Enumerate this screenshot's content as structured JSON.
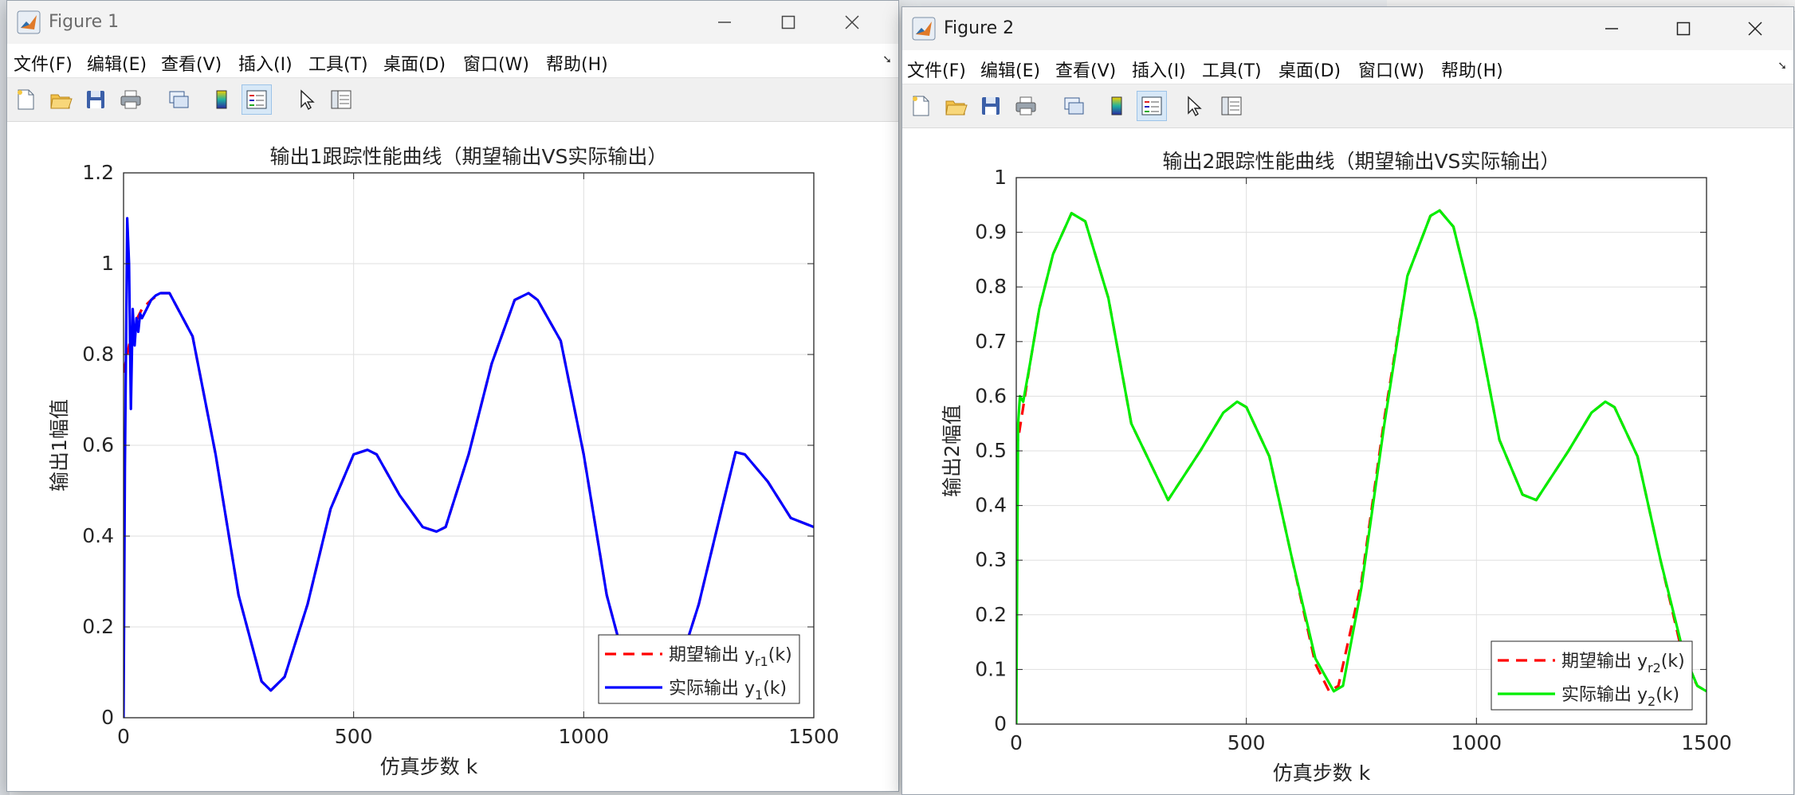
{
  "windows": [
    {
      "title": "Figure 1",
      "menu": [
        "文件(F)",
        "编辑(E)",
        "查看(V)",
        "插入(I)",
        "工具(T)",
        "桌面(D)",
        "窗口(W)",
        "帮助(H)"
      ],
      "chart_data": {
        "type": "line",
        "title": "输出1跟踪性能曲线（期望输出VS实际输出）",
        "xlabel": "仿真步数 k",
        "ylabel": "输出1幅值",
        "xlim": [
          0,
          1500
        ],
        "ylim": [
          0,
          1.2
        ],
        "xticks": [
          0,
          500,
          1000,
          1500
        ],
        "yticks": [
          0,
          0.2,
          0.4,
          0.6,
          0.8,
          1,
          1.2
        ],
        "ytick_labels": [
          "0",
          "0.2",
          "0.4",
          "0.6",
          "0.8",
          "1",
          "1.2"
        ],
        "grid": true,
        "legend_placement": "bottom-right",
        "series": [
          {
            "name": "期望输出 yr1(k)",
            "legend_main": "期望输出 y",
            "legend_sub": "r1",
            "legend_tail": "(k)",
            "style": "dashed",
            "color": "#ff0000",
            "x": [
              0,
              20,
              40,
              60,
              80,
              100,
              150,
              200,
              250,
              300,
              320,
              350,
              400,
              450,
              500,
              530,
              550,
              600,
              650,
              680,
              700,
              750,
              800,
              850,
              880,
              900,
              950,
              1000,
              1050,
              1100,
              1150,
              1200,
              1250,
              1300,
              1330,
              1350,
              1400,
              1450,
              1500
            ],
            "y": [
              0.76,
              0.86,
              0.9,
              0.92,
              0.935,
              0.935,
              0.84,
              0.58,
              0.27,
              0.08,
              0.06,
              0.09,
              0.25,
              0.46,
              0.58,
              0.59,
              0.58,
              0.49,
              0.42,
              0.41,
              0.42,
              0.58,
              0.78,
              0.92,
              0.935,
              0.92,
              0.83,
              0.58,
              0.27,
              0.08,
              0.06,
              0.09,
              0.25,
              0.46,
              0.585,
              0.58,
              0.52,
              0.44,
              0.42
            ]
          },
          {
            "name": "实际输出 y1(k)",
            "legend_main": "实际输出 y",
            "legend_sub": "1",
            "legend_tail": "(k)",
            "style": "solid",
            "color": "#0000ff",
            "x": [
              0,
              3,
              8,
              12,
              16,
              20,
              24,
              28,
              32,
              36,
              40,
              50,
              60,
              70,
              80,
              100,
              150,
              200,
              250,
              300,
              320,
              350,
              400,
              450,
              500,
              530,
              550,
              600,
              650,
              680,
              700,
              750,
              800,
              850,
              880,
              900,
              950,
              1000,
              1050,
              1100,
              1150,
              1200,
              1250,
              1300,
              1330,
              1350,
              1400,
              1450,
              1500
            ],
            "y": [
              0,
              0.55,
              1.1,
              1.0,
              0.68,
              0.9,
              0.82,
              0.88,
              0.85,
              0.89,
              0.88,
              0.9,
              0.92,
              0.93,
              0.935,
              0.935,
              0.84,
              0.58,
              0.27,
              0.08,
              0.06,
              0.09,
              0.25,
              0.46,
              0.58,
              0.59,
              0.58,
              0.49,
              0.42,
              0.41,
              0.42,
              0.58,
              0.78,
              0.92,
              0.935,
              0.92,
              0.83,
              0.58,
              0.27,
              0.08,
              0.06,
              0.09,
              0.25,
              0.46,
              0.585,
              0.58,
              0.52,
              0.44,
              0.42
            ]
          }
        ]
      }
    },
    {
      "title": "Figure 2",
      "menu": [
        "文件(F)",
        "编辑(E)",
        "查看(V)",
        "插入(I)",
        "工具(T)",
        "桌面(D)",
        "窗口(W)",
        "帮助(H)"
      ],
      "chart_data": {
        "type": "line",
        "title": "输出2跟踪性能曲线（期望输出VS实际输出）",
        "xlabel": "仿真步数 k",
        "ylabel": "输出2幅值",
        "xlim": [
          0,
          1500
        ],
        "ylim": [
          0,
          1
        ],
        "xticks": [
          0,
          500,
          1000,
          1500
        ],
        "yticks": [
          0,
          0.1,
          0.2,
          0.3,
          0.4,
          0.5,
          0.6,
          0.7,
          0.8,
          0.9,
          1
        ],
        "ytick_labels": [
          "0",
          "0.1",
          "0.2",
          "0.3",
          "0.4",
          "0.5",
          "0.6",
          "0.7",
          "0.8",
          "0.9",
          "1"
        ],
        "grid": true,
        "legend_placement": "bottom-right",
        "series": [
          {
            "name": "期望输出 yr2(k)",
            "legend_main": "期望输出 y",
            "legend_sub": "r2",
            "legend_tail": "(k)",
            "style": "dashed",
            "color": "#ff0000",
            "x": [
              0,
              15,
              30,
              50,
              80,
              120,
              150,
              200,
              250,
              330,
              400,
              450,
              480,
              500,
              550,
              600,
              650,
              680,
              700,
              750,
              800,
              850,
              900,
              920,
              950,
              1000,
              1050,
              1100,
              1130,
              1200,
              1250,
              1280,
              1300,
              1350,
              1400,
              1450,
              1480,
              1500
            ],
            "y": [
              0.5,
              0.58,
              0.66,
              0.76,
              0.86,
              0.935,
              0.92,
              0.78,
              0.55,
              0.41,
              0.5,
              0.57,
              0.59,
              0.58,
              0.49,
              0.3,
              0.11,
              0.06,
              0.07,
              0.26,
              0.56,
              0.82,
              0.93,
              0.94,
              0.91,
              0.74,
              0.52,
              0.42,
              0.41,
              0.5,
              0.57,
              0.59,
              0.58,
              0.49,
              0.3,
              0.12,
              0.07,
              0.06
            ]
          },
          {
            "name": "实际输出 y2(k)",
            "legend_main": "实际输出 y",
            "legend_sub": "2",
            "legend_tail": "(k)",
            "style": "solid",
            "color": "#00ee00",
            "x": [
              0,
              4,
              8,
              15,
              30,
              50,
              80,
              120,
              150,
              200,
              250,
              330,
              400,
              450,
              480,
              500,
              550,
              600,
              650,
              690,
              710,
              750,
              800,
              850,
              900,
              920,
              950,
              1000,
              1050,
              1100,
              1130,
              1200,
              1250,
              1280,
              1300,
              1350,
              1400,
              1450,
              1480,
              1500
            ],
            "y": [
              0,
              0.55,
              0.6,
              0.59,
              0.66,
              0.76,
              0.86,
              0.935,
              0.92,
              0.78,
              0.55,
              0.41,
              0.5,
              0.57,
              0.59,
              0.58,
              0.49,
              0.3,
              0.12,
              0.06,
              0.07,
              0.25,
              0.55,
              0.82,
              0.93,
              0.94,
              0.91,
              0.74,
              0.52,
              0.42,
              0.41,
              0.5,
              0.57,
              0.59,
              0.58,
              0.49,
              0.3,
              0.13,
              0.07,
              0.06
            ]
          }
        ]
      }
    }
  ]
}
